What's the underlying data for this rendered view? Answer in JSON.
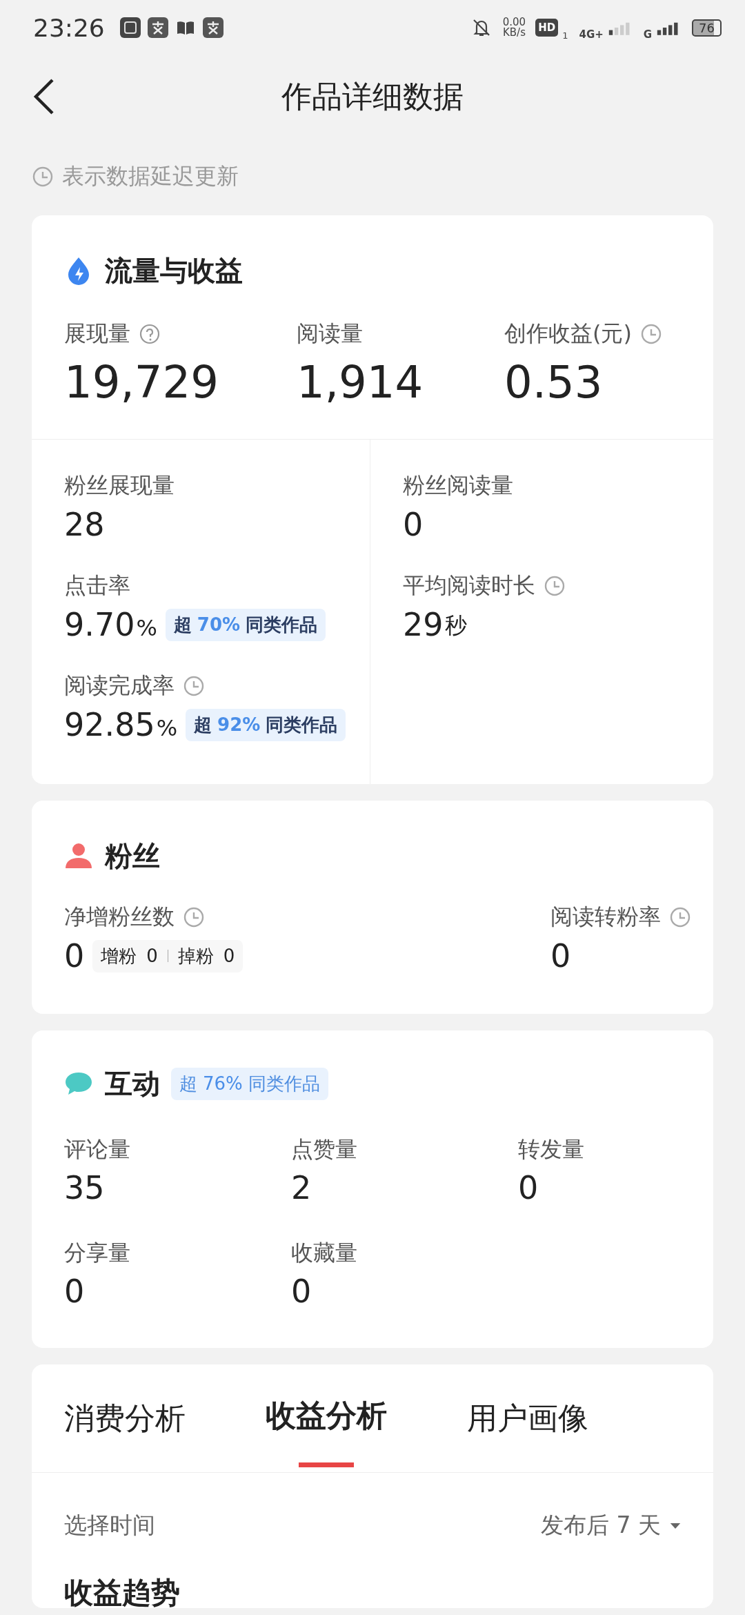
{
  "status_bar": {
    "time": "23:26",
    "speed": "0.00",
    "speed_unit": "KB/s",
    "hd": "HD",
    "sim": "1",
    "network": "4G+",
    "network2": "G",
    "battery": "76"
  },
  "header": {
    "title": "作品详细数据"
  },
  "note": "表示数据延迟更新",
  "traffic": {
    "title": "流量与收益",
    "top": [
      {
        "label": "展现量",
        "kind": "help",
        "value": "19,729"
      },
      {
        "label": "阅读量",
        "value": "1,914"
      },
      {
        "label": "创作收益(元)",
        "kind": "delayed",
        "value": "0.53"
      }
    ],
    "left": [
      {
        "label": "粉丝展现量",
        "value": "28"
      },
      {
        "label": "点击率",
        "value": "9.70",
        "unit": "%",
        "badge": {
          "kind": "dark",
          "prefix": "超",
          "pct": "70%",
          "suffix": "同类作品"
        }
      },
      {
        "label": "阅读完成率",
        "kind": "delayed",
        "value": "92.85",
        "unit": "%",
        "badge": {
          "kind": "dark",
          "prefix": "超",
          "pct": "92%",
          "suffix": "同类作品"
        }
      }
    ],
    "right": [
      {
        "label": "粉丝阅读量",
        "value": "0"
      },
      {
        "label": "平均阅读时长",
        "kind": "delayed",
        "value": "29",
        "unit": "秒"
      }
    ]
  },
  "fans": {
    "title": "粉丝",
    "net": {
      "label": "净增粉丝数",
      "kind": "delayed",
      "value": "0",
      "gain_label": "增粉",
      "gain": "0",
      "loss_label": "掉粉",
      "loss": "0"
    },
    "rate": {
      "label": "阅读转粉率",
      "kind": "delayed",
      "value": "0"
    }
  },
  "interaction": {
    "title": "互动",
    "badge": {
      "kind": "light",
      "prefix": "超",
      "pct": "76%",
      "suffix": "同类作品"
    },
    "metrics": [
      {
        "label": "评论量",
        "value": "35"
      },
      {
        "label": "点赞量",
        "value": "2"
      },
      {
        "label": "转发量",
        "value": "0"
      },
      {
        "label": "分享量",
        "value": "0"
      },
      {
        "label": "收藏量",
        "value": "0"
      }
    ]
  },
  "analysis": {
    "tabs": [
      {
        "label": "消费分析",
        "selected": false
      },
      {
        "label": "收益分析",
        "selected": true
      },
      {
        "label": "用户画像",
        "selected": false
      }
    ],
    "time_label": "选择时间",
    "time_value": "发布后 7 天",
    "trend_title": "收益趋势"
  }
}
